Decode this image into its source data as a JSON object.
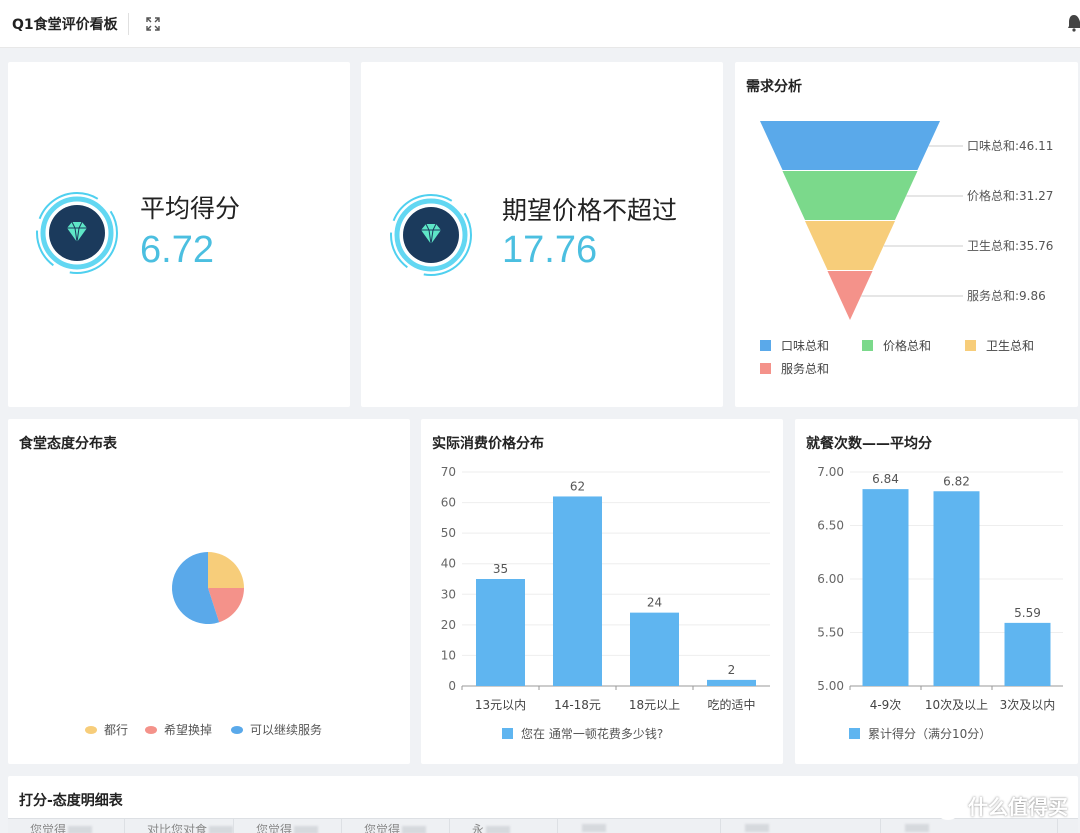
{
  "header": {
    "title": "Q1食堂评价看板"
  },
  "kpis": [
    {
      "label": "平均得分",
      "value": "6.72"
    },
    {
      "label": "期望价格不超过",
      "value": "17.76"
    }
  ],
  "funnel": {
    "title": "需求分析",
    "items": [
      {
        "name": "口味总和",
        "value": 46.11,
        "color": "#5aa9ea",
        "label": "口味总和:46.11"
      },
      {
        "name": "价格总和",
        "value": 31.27,
        "color": "#7bd98b",
        "label": "价格总和:31.27"
      },
      {
        "name": "卫生总和",
        "value": 35.76,
        "color": "#f7cd7a",
        "label": "卫生总和:35.76"
      },
      {
        "name": "服务总和",
        "value": 9.86,
        "color": "#f4928a",
        "label": "服务总和:9.86"
      }
    ]
  },
  "chart_data": [
    {
      "type": "pie",
      "title": "食堂态度分布表",
      "slices": [
        {
          "name": "都行",
          "value": 0.25,
          "color": "#f7cd7a"
        },
        {
          "name": "希望换掉",
          "value": 0.2,
          "color": "#f4928a"
        },
        {
          "name": "可以继续服务",
          "value": 0.55,
          "color": "#5aa9ea"
        }
      ]
    },
    {
      "type": "bar",
      "title": "实际消费价格分布",
      "categories": [
        "13元以内",
        "14-18元",
        "18元以上",
        "吃的适中"
      ],
      "values": [
        35,
        62,
        24,
        2
      ],
      "ylim": [
        0,
        70
      ],
      "yticks": [
        "0",
        "10",
        "20",
        "30",
        "40",
        "50",
        "60",
        "70"
      ],
      "legend": "您在 通常一顿花费多少钱?"
    },
    {
      "type": "bar",
      "title": "就餐次数——平均分",
      "categories": [
        "4-9次",
        "10次及以上",
        "3次及以内"
      ],
      "values": [
        6.84,
        6.82,
        5.59
      ],
      "ylim": [
        5.0,
        7.0
      ],
      "yticks": [
        "5.00",
        "5.50",
        "6.00",
        "6.50",
        "7.00"
      ],
      "legend": "累计得分（满分10分）"
    }
  ],
  "table": {
    "title": "打分-态度明细表",
    "headers": [
      "您觉得",
      "对比您对食",
      "您觉得",
      "您觉得",
      "永",
      "",
      "",
      ""
    ]
  },
  "brand": {
    "text": "什么值得买",
    "glyph": "值"
  }
}
